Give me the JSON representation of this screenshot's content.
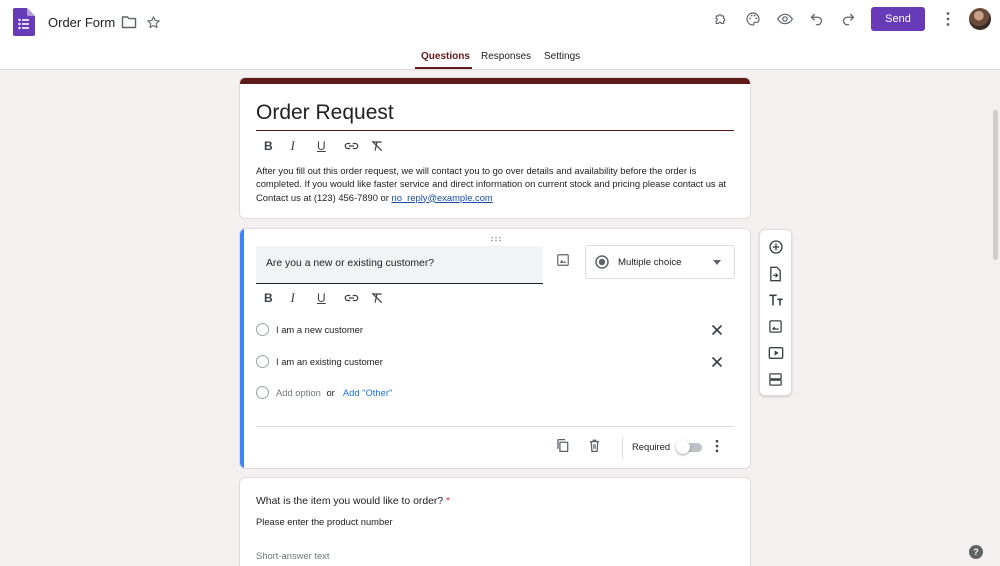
{
  "header": {
    "doc_title": "Order Form",
    "send_label": "Send"
  },
  "tabs": [
    {
      "label": "Questions",
      "active": true
    },
    {
      "label": "Responses",
      "active": false
    },
    {
      "label": "Settings",
      "active": false
    }
  ],
  "colors": {
    "theme": "#5f1b18",
    "send_button": "#673ab7",
    "active_question_bar": "#4285f4",
    "link": "#1a73e8",
    "required_star": "#d93025"
  },
  "title_card": {
    "title": "Order Request",
    "format_tools": [
      "B",
      "I",
      "U",
      "link-icon",
      "clear-format-icon"
    ],
    "description_text": "After you fill out this order request, we will contact you to go over details and availability before the order is completed. If you would like faster service and direct information on current stock and pricing please contact us at Contact us at (123) 456-7890 or ",
    "description_link": "no_reply@example.com"
  },
  "question1": {
    "text": "Are you a new or existing customer?",
    "type": "Multiple choice",
    "options": [
      "I am a new customer",
      "I am an existing customer"
    ],
    "add_option": "Add option",
    "or": "or",
    "add_other": "Add \"Other\"",
    "required_label": "Required",
    "required": false
  },
  "question2": {
    "title": "What is the item you would like to order?",
    "required_marker": "*",
    "description": "Please enter the product number",
    "placeholder": "Short-answer text"
  },
  "rail_tools": [
    "add-question-icon",
    "import-questions-icon",
    "add-title-icon",
    "add-image-icon",
    "add-video-icon",
    "add-section-icon"
  ],
  "help": "?"
}
